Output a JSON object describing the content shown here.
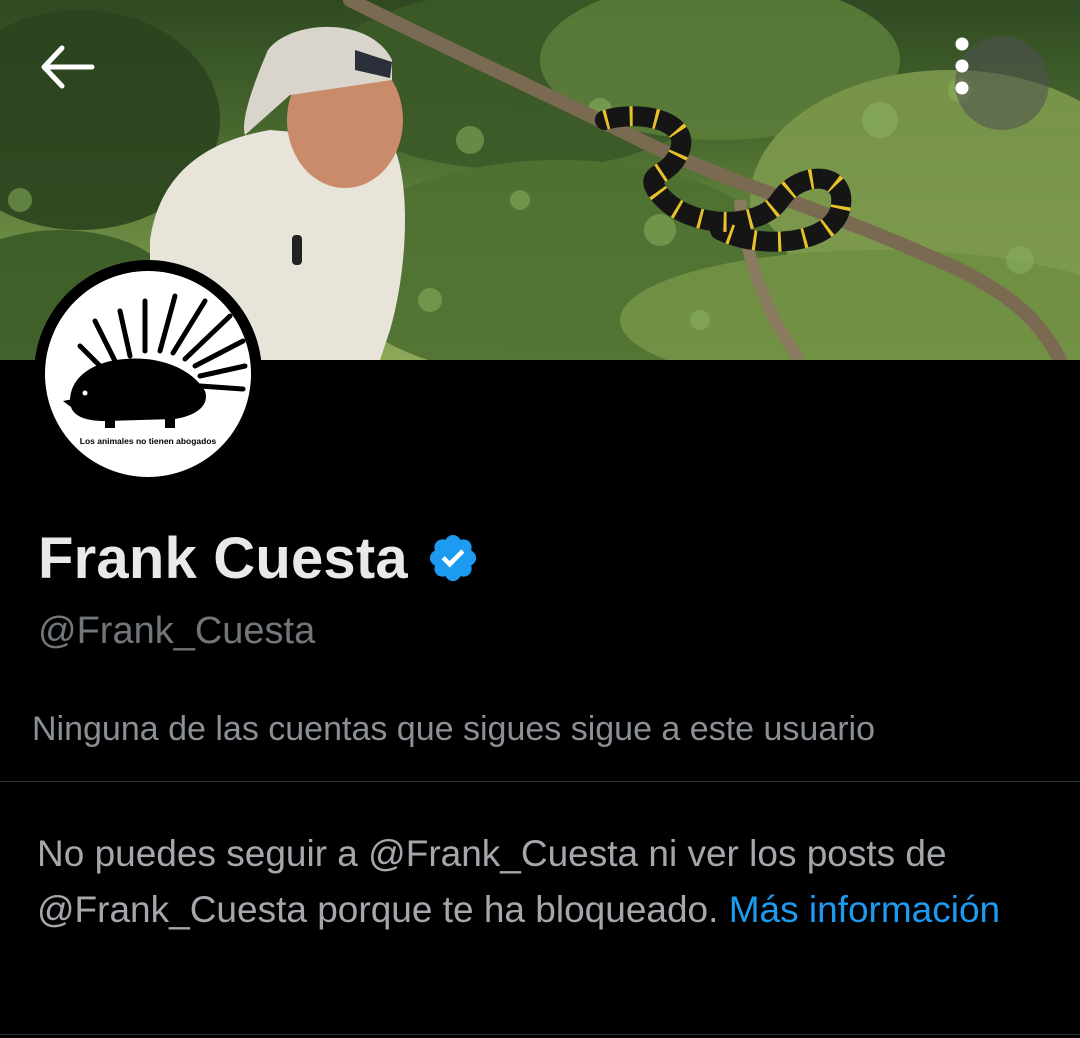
{
  "profile": {
    "display_name": "Frank Cuesta",
    "handle": "@Frank_Cuesta",
    "verified": true,
    "avatar_caption": "Los animales no tienen abogados"
  },
  "followers_note": "Ninguna de las cuentas que sigues sigue a este usuario",
  "blocked": {
    "message": "No puedes seguir a @Frank_Cuesta ni ver los posts de @Frank_Cuesta porque te ha bloqueado.",
    "link_label": "Más información"
  },
  "icons": {
    "back": "arrow-left-icon",
    "more": "more-vertical-icon",
    "verified": "verified-badge-icon"
  },
  "colors": {
    "background": "#000000",
    "text_primary": "#e7e9ea",
    "text_secondary": "#71767b",
    "link": "#1d9bf0",
    "verified": "#1d9bf0"
  }
}
